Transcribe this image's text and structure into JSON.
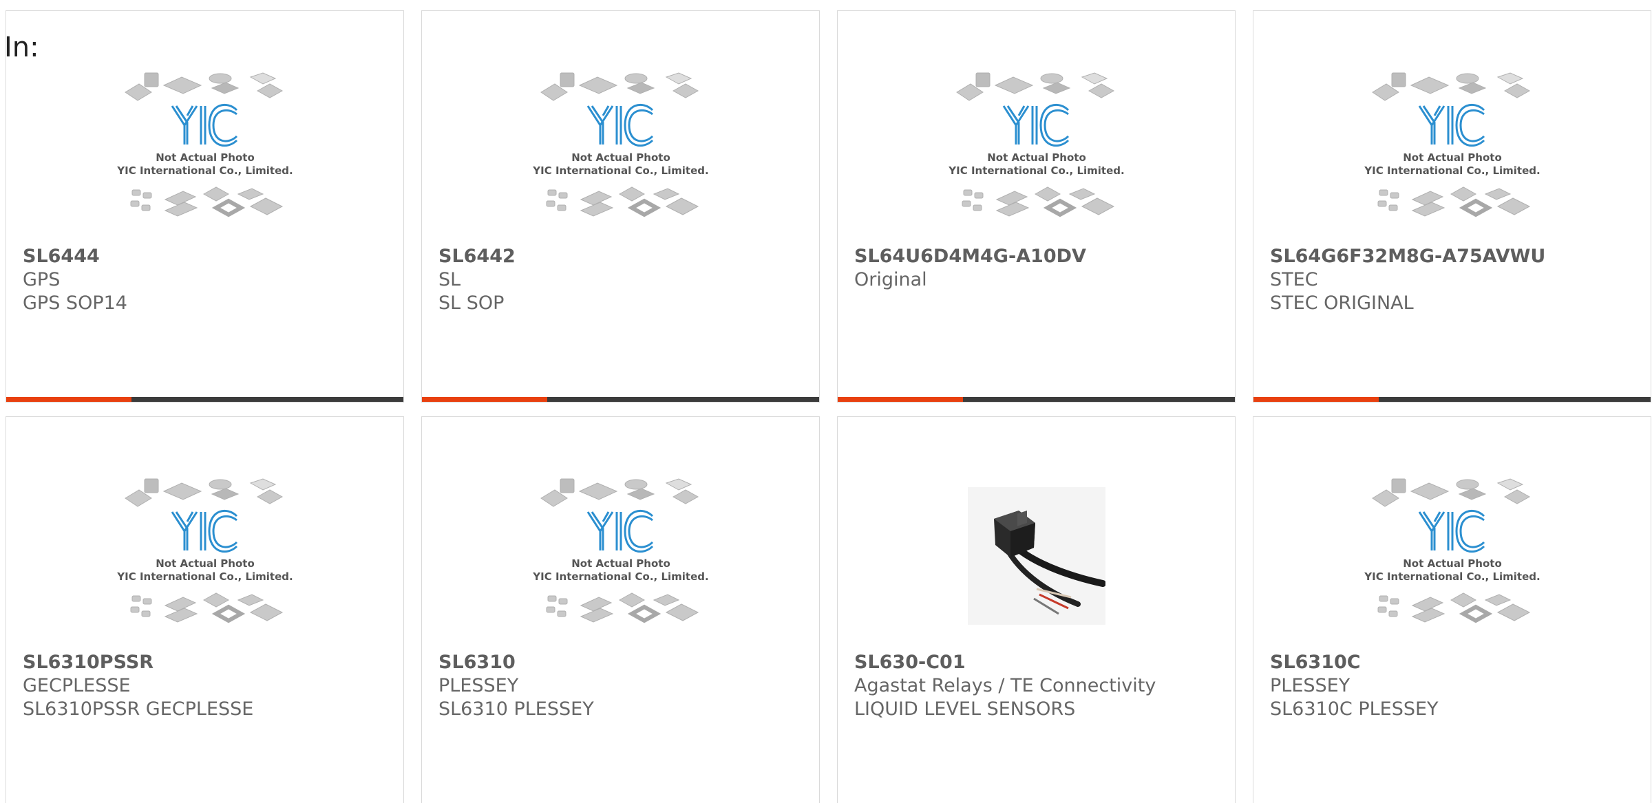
{
  "heading": "In:",
  "placeholder": {
    "logo": "YIC",
    "line1": "Not Actual Photo",
    "line2": "YIC International Co., Limited."
  },
  "colors": {
    "accent": "#e8400f",
    "bar": "#3b3b3b",
    "logo": "#2b8fd0"
  },
  "products": [
    {
      "part": "SL6444",
      "brand": "GPS",
      "desc": "GPS SOP14",
      "image": "placeholder"
    },
    {
      "part": "SL6442",
      "brand": "SL",
      "desc": "SL SOP",
      "image": "placeholder"
    },
    {
      "part": "SL64U6D4M4G-A10DV",
      "brand": "Original",
      "desc": "",
      "image": "placeholder"
    },
    {
      "part": "SL64G6F32M8G-A75AVWU",
      "brand": "STEC",
      "desc": "STEC ORIGINAL",
      "image": "placeholder"
    },
    {
      "part": "SL6310PSSR",
      "brand": "GECPLESSE",
      "desc": "SL6310PSSR GECPLESSE",
      "image": "placeholder"
    },
    {
      "part": "SL6310",
      "brand": "PLESSEY",
      "desc": "SL6310 PLESSEY",
      "image": "placeholder"
    },
    {
      "part": "SL630-C01",
      "brand": "Agastat Relays / TE Connectivity",
      "desc": "LIQUID LEVEL SENSORS",
      "image": "sensor-photo"
    },
    {
      "part": "SL6310C",
      "brand": "PLESSEY",
      "desc": "SL6310C PLESSEY",
      "image": "placeholder"
    }
  ]
}
